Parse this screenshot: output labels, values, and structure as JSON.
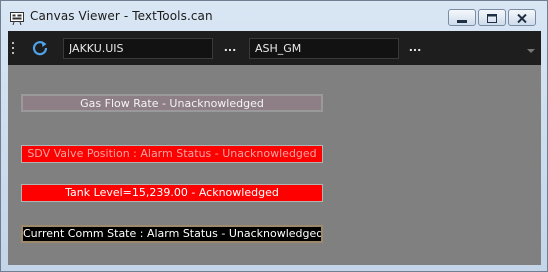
{
  "window": {
    "title": "Canvas Viewer - TextTools.can",
    "controls": [
      "minimize-icon",
      "maximize-icon",
      "close-icon"
    ]
  },
  "toolbar": {
    "refresh_icon": "refresh-icon",
    "field1_value": "JAKKU.UIS",
    "field1_browse": "...",
    "field2_value": "ASH_GM",
    "field2_browse": "..."
  },
  "canvas": {
    "background": "#808080",
    "labels": [
      {
        "text": "Gas Flow Rate - Unacknowledged",
        "bg": "#8e7f86",
        "fg": "#f4f4f4"
      },
      {
        "text": "SDV Valve Position : Alarm Status - Unacknowledged",
        "bg": "#ff0000",
        "fg": "#f2a3a3"
      },
      {
        "text": "Tank Level=15,239.00 - Acknowledged",
        "bg": "#ff0000",
        "fg": "#ffffff"
      },
      {
        "text": "Current Comm State : Alarm Status - Unacknowledged",
        "bg": "#000000",
        "fg": "#ffffff"
      }
    ]
  }
}
